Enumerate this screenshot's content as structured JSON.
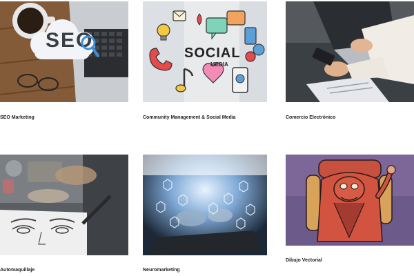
{
  "courses": [
    {
      "title": "SEO Marketing",
      "image": "seo-laptop-coffee-photo",
      "overlay_text": "SEO"
    },
    {
      "title": "Community Management & Social Media",
      "image": "social-media-icons-illustration",
      "overlay_text": "SOCIAL",
      "overlay_subtext": "MEDIA"
    },
    {
      "title": "Comercio Electrónico",
      "image": "ecommerce-phone-laptop-photo"
    },
    {
      "title": "Automaquillaje",
      "image": "makeup-face-sketch-photo"
    },
    {
      "title": "Neuromarketing",
      "image": "neuromarketing-tablet-icons-photo"
    },
    {
      "title": "Dibujo Vectorial",
      "image": "vector-character-illustration"
    }
  ]
}
